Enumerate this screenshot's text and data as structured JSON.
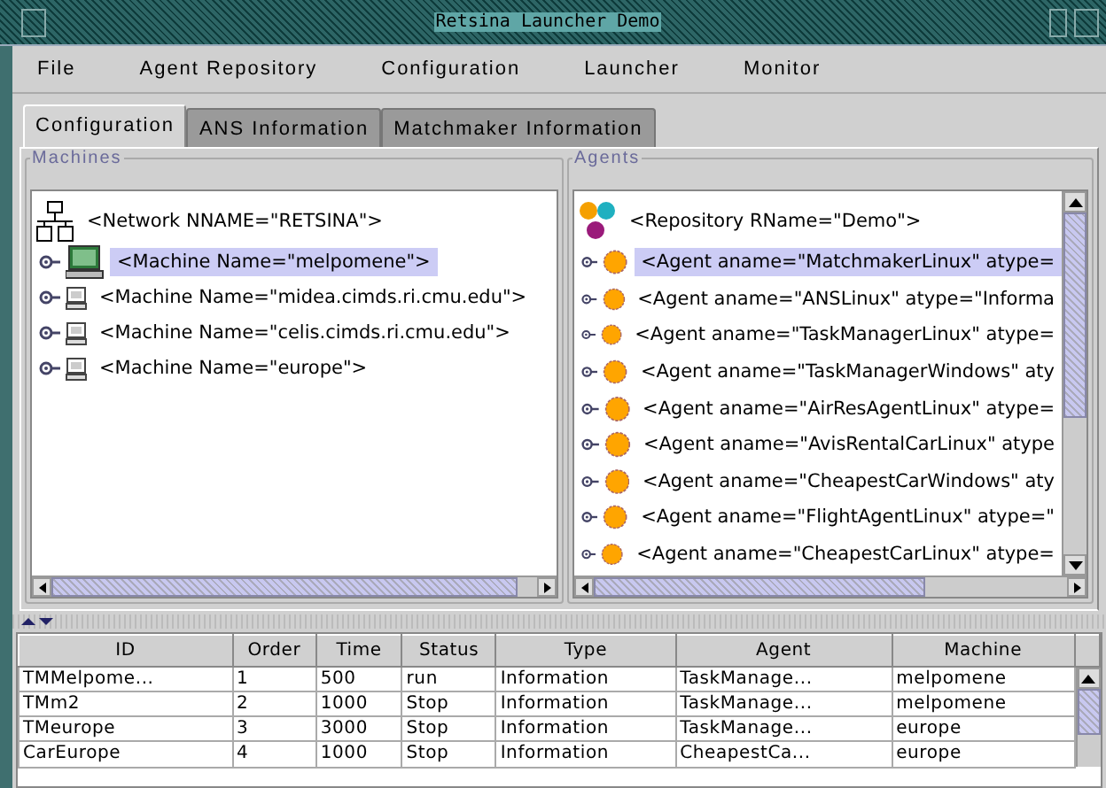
{
  "window": {
    "title": "Retsina Launcher Demo"
  },
  "menu": [
    "File",
    "Agent Repository",
    "Configuration",
    "Launcher",
    "Monitor"
  ],
  "tabs": [
    {
      "label": "Configuration",
      "selected": true
    },
    {
      "label": "ANS Information",
      "selected": false
    },
    {
      "label": "Matchmaker Information",
      "selected": false
    }
  ],
  "machines": {
    "title": "Machines",
    "root": "<Network NNAME=\"RETSINA\">",
    "items": [
      {
        "label": "<Machine Name=\"melpomene\">",
        "selected": true
      },
      {
        "label": "<Machine Name=\"midea.cimds.ri.cmu.edu\">",
        "selected": false
      },
      {
        "label": "<Machine Name=\"celis.cimds.ri.cmu.edu\">",
        "selected": false
      },
      {
        "label": "<Machine Name=\"europe\">",
        "selected": false
      }
    ]
  },
  "agents": {
    "title": "Agents",
    "root": "<Repository RName=\"Demo\">",
    "items": [
      {
        "label": "<Agent aname=\"MatchmakerLinux\" atype=",
        "selected": true
      },
      {
        "label": "<Agent aname=\"ANSLinux\" atype=\"Informa",
        "selected": false
      },
      {
        "label": "<Agent aname=\"TaskManagerLinux\" atype=",
        "selected": false
      },
      {
        "label": "<Agent aname=\"TaskManagerWindows\" aty",
        "selected": false
      },
      {
        "label": "<Agent aname=\"AirResAgentLinux\" atype=",
        "selected": false
      },
      {
        "label": "<Agent aname=\"AvisRentalCarLinux\" atype",
        "selected": false
      },
      {
        "label": "<Agent aname=\"CheapestCarWindows\" aty",
        "selected": false
      },
      {
        "label": "<Agent aname=\"FlightAgentLinux\" atype=\"",
        "selected": false
      },
      {
        "label": "<Agent aname=\"CheapestCarLinux\" atype=",
        "selected": false
      }
    ]
  },
  "table": {
    "columns": [
      "ID",
      "Order",
      "Time",
      "Status",
      "Type",
      "Agent",
      "Machine"
    ],
    "rows": [
      [
        "TMMelpome...",
        "1",
        "500",
        "run",
        "Information",
        "TaskManage...",
        "melpomene"
      ],
      [
        "TMm2",
        "2",
        "1000",
        "Stop",
        "Information",
        "TaskManage...",
        "melpomene"
      ],
      [
        "TMeurope",
        "3",
        "3000",
        "Stop",
        "Information",
        "TaskManage...",
        "europe"
      ],
      [
        "CarEurope",
        "4",
        "1000",
        "Stop",
        "Information",
        "CheapestCa...",
        "europe"
      ]
    ]
  }
}
